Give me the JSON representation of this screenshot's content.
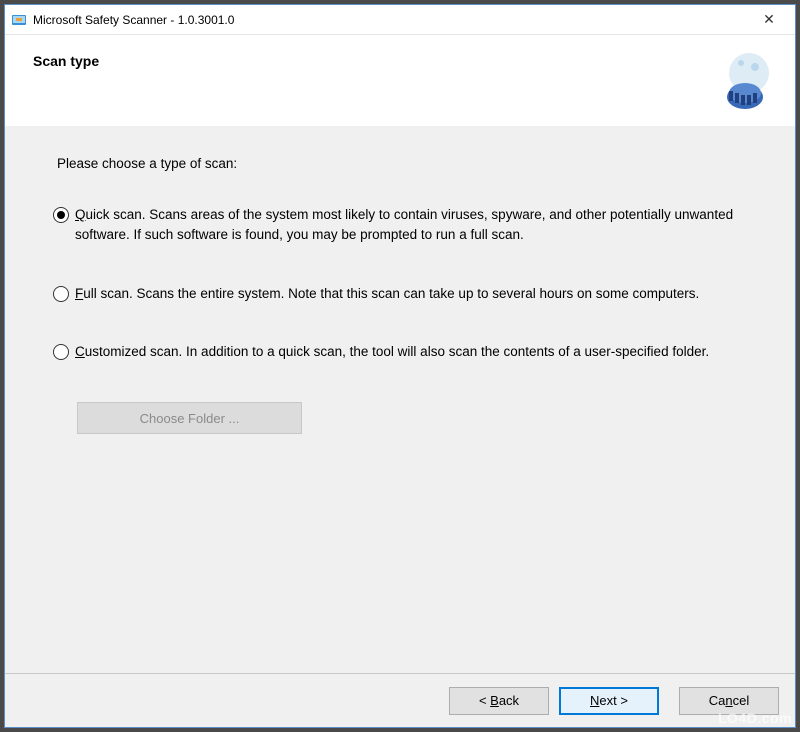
{
  "titlebar": {
    "title": "Microsoft Safety Scanner - 1.0.3001.0",
    "close_symbol": "✕"
  },
  "header": {
    "title": "Scan type"
  },
  "content": {
    "prompt": "Please choose a type of scan:",
    "options": [
      {
        "mnemonic": "Q",
        "rest": "uick scan. Scans areas of the system most likely to contain viruses, spyware, and other potentially unwanted software. If such software is found, you may be prompted to run a full scan.",
        "checked": true
      },
      {
        "mnemonic": "F",
        "rest": "ull scan. Scans the entire system. Note that this scan can take up to several hours on some computers.",
        "checked": false
      },
      {
        "mnemonic": "C",
        "rest": "ustomized scan. In addition to a quick scan, the tool will also scan the contents of a user-specified folder.",
        "checked": false
      }
    ],
    "choose_folder_label": "Choose Folder ..."
  },
  "footer": {
    "back": {
      "prefix": "< ",
      "mnemonic": "B",
      "rest": "ack"
    },
    "next": {
      "mnemonic": "N",
      "rest": "ext >"
    },
    "cancel": {
      "prefix": "Ca",
      "mnemonic": "n",
      "rest": "cel"
    }
  },
  "watermark": "LO4D.com"
}
